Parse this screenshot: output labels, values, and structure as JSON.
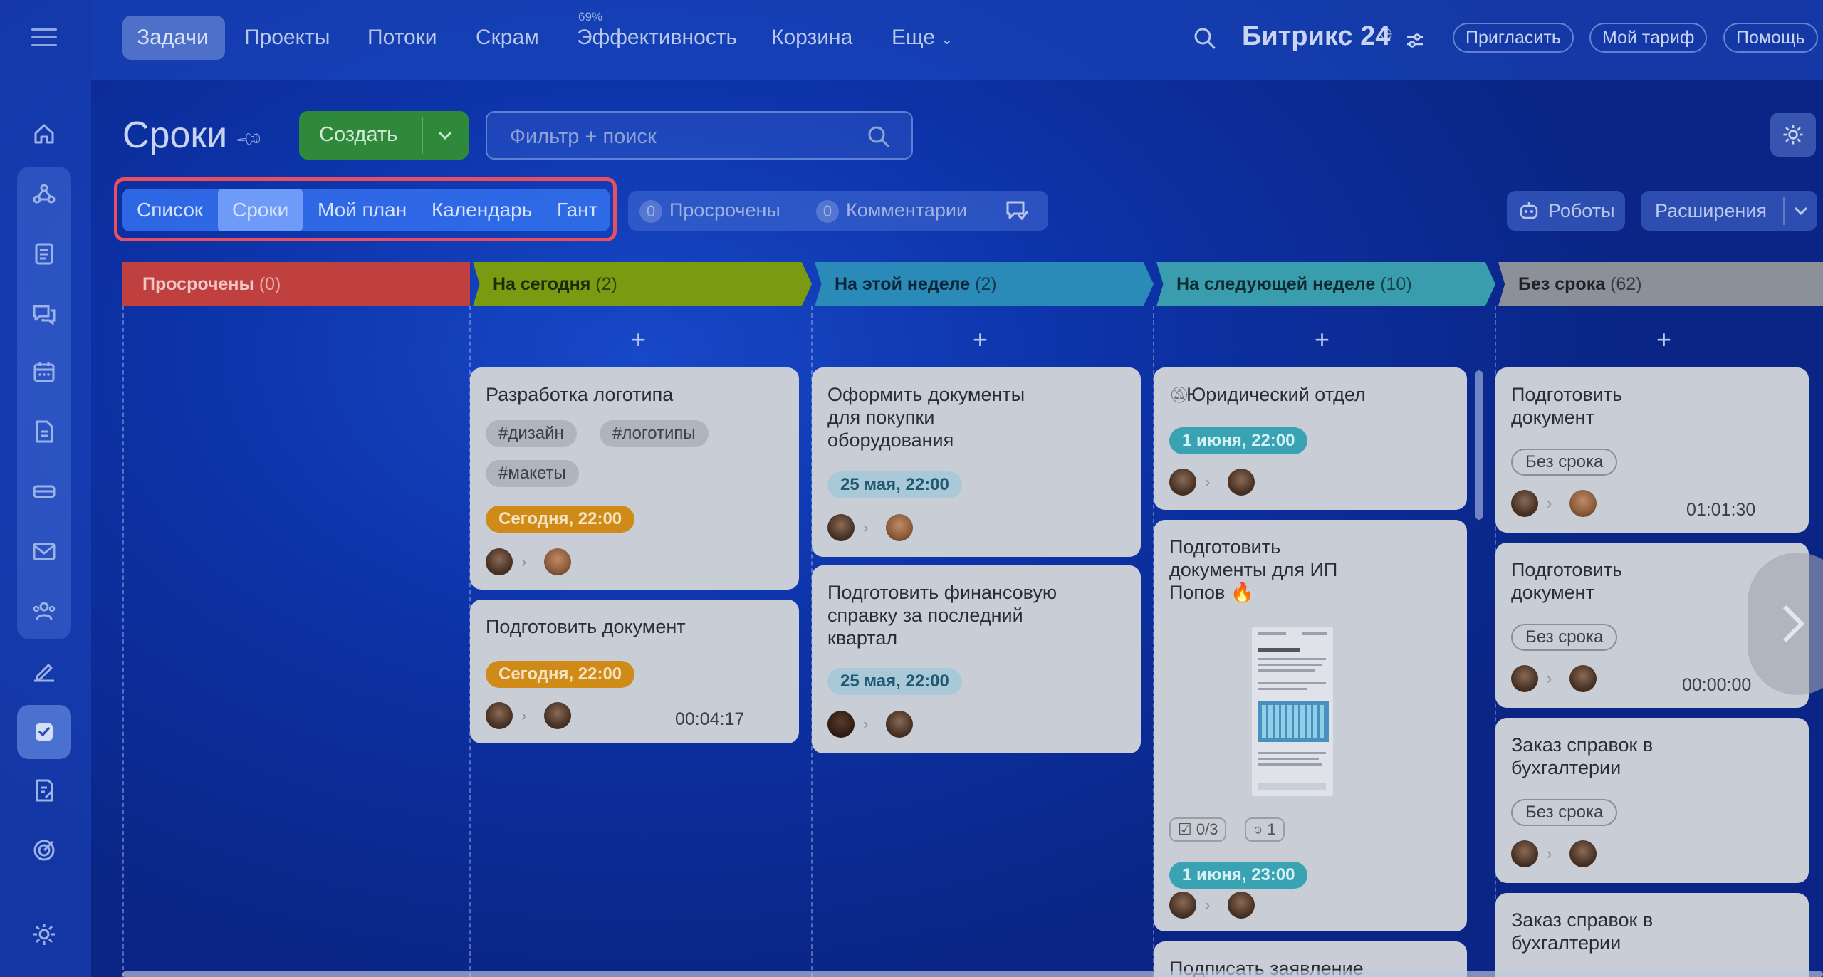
{
  "topnav": {
    "items": [
      "Задачи",
      "Проекты",
      "Потоки",
      "Скрам",
      "Эффективность",
      "Корзина",
      "Еще"
    ],
    "efficiency_pct": "69%",
    "logo": "Битрикс 24",
    "invite": "Пригласить",
    "tariff": "Мой тариф",
    "help": "Помощь"
  },
  "sidebar": {
    "icons": [
      "home-icon",
      "crm-icon",
      "feed-icon",
      "chat-icon",
      "calendar-icon",
      "document-icon",
      "drive-icon",
      "mail-icon",
      "team-icon",
      "sign-icon",
      "tasks-icon",
      "forms-icon",
      "goals-icon",
      "settings-icon"
    ]
  },
  "header": {
    "title": "Сроки",
    "create": "Создать",
    "search_placeholder": "Фильтр + поиск"
  },
  "views": {
    "tabs": [
      "Список",
      "Сроки",
      "Мой план",
      "Календарь",
      "Гант"
    ],
    "active": "Сроки"
  },
  "counters": {
    "overdue_count": "0",
    "overdue_label": "Просрочены",
    "comments_count": "0",
    "comments_label": "Комментарии"
  },
  "right_buttons": {
    "robots": "Роботы",
    "extensions": "Расширения"
  },
  "colors": {
    "overdue": "#c0403f",
    "today": "#7a9a12",
    "this_week": "#2a8ab8",
    "next_week": "#3a9dae",
    "no_deadline": "#8c9098",
    "accent_highlight": "#e84f60"
  },
  "columns": [
    {
      "name": "Просрочены",
      "count": "(0)"
    },
    {
      "name": "На сегодня",
      "count": "(2)"
    },
    {
      "name": "На этой неделе",
      "count": "(2)"
    },
    {
      "name": "На следующей неделе",
      "count": "(10)"
    },
    {
      "name": "Без срока",
      "count": "(62)"
    }
  ],
  "cards": {
    "today1": {
      "title": "Разработка логотипа",
      "tags": [
        "#дизайн",
        "#логотипы",
        "#макеты"
      ],
      "deadline": "Сегодня, 22:00"
    },
    "today2": {
      "title": "Подготовить документ",
      "deadline": "Сегодня, 22:00",
      "timer": "00:04:17"
    },
    "week1": {
      "title": "Оформить документы для покупки оборудования",
      "deadline": "25 мая, 22:00"
    },
    "week2": {
      "title": "Подготовить финансовую справку за последний квартал",
      "deadline": "25 мая, 22:00"
    },
    "next1": {
      "title": "Юридический отдел",
      "deadline": "1 июня, 22:00"
    },
    "next2": {
      "title": "Подготовить документы для ИП Попов 🔥",
      "checklist": "0/3",
      "attachments": "1",
      "deadline": "1 июня, 23:00"
    },
    "next3": {
      "title": "Подписать заявление"
    },
    "none1": {
      "title": "Подготовить документ",
      "deadline": "Без срока",
      "timer": "01:01:30"
    },
    "none2": {
      "title": "Подготовить документ",
      "deadline": "Без срока",
      "timer": "00:00:00"
    },
    "none3": {
      "title": "Заказ справок в бухгалтерии",
      "deadline": "Без срока"
    },
    "none4": {
      "title": "Заказ справок в бухгалтерии"
    }
  }
}
